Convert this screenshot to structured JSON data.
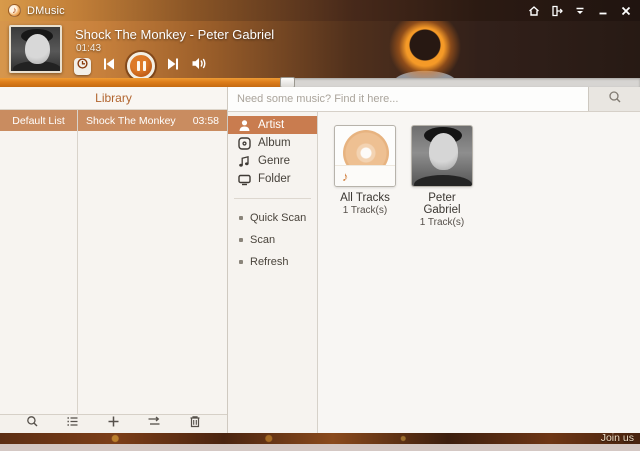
{
  "window": {
    "title": "DMusic"
  },
  "titlebar": {
    "controls": {
      "home": "home",
      "sign_out": "sign-out",
      "menu": "menu",
      "minimize": "minimize",
      "close": "close"
    }
  },
  "player": {
    "track_title": "Shock The Monkey - Peter Gabriel",
    "elapsed": "01:43",
    "progress_percent": 45,
    "logo_glyph": "♪"
  },
  "library": {
    "header": "Library",
    "playlists": [
      {
        "name": "Default List",
        "selected": true
      }
    ],
    "tracks": [
      {
        "title": "Shock The Monkey",
        "duration": "03:58",
        "selected": true
      }
    ]
  },
  "search": {
    "placeholder": "Need some music? Find it here..."
  },
  "sidebar": {
    "nav": [
      {
        "label": "Artist",
        "selected": true
      },
      {
        "label": "Album",
        "selected": false
      },
      {
        "label": "Genre",
        "selected": false
      },
      {
        "label": "Folder",
        "selected": false
      }
    ],
    "actions": [
      {
        "label": "Quick Scan"
      },
      {
        "label": "Scan"
      },
      {
        "label": "Refresh"
      }
    ],
    "genre_glyph": "♪"
  },
  "content": {
    "cards": [
      {
        "title": "All Tracks",
        "subtitle": "1 Track(s)",
        "note_glyph": "♪"
      },
      {
        "title": "Peter Gabriel",
        "subtitle": "1 Track(s)"
      }
    ]
  },
  "statusbar": {
    "join_label": "Join us"
  },
  "colors": {
    "accent_selected_nav": "#c97c4f",
    "accent_selected_row": "#c98c60",
    "progress_fill": "#dd7d1b",
    "library_header_text": "#b2652f",
    "statusbar_bg": "#4a2410",
    "panel_bg": "#f7f4f0"
  }
}
